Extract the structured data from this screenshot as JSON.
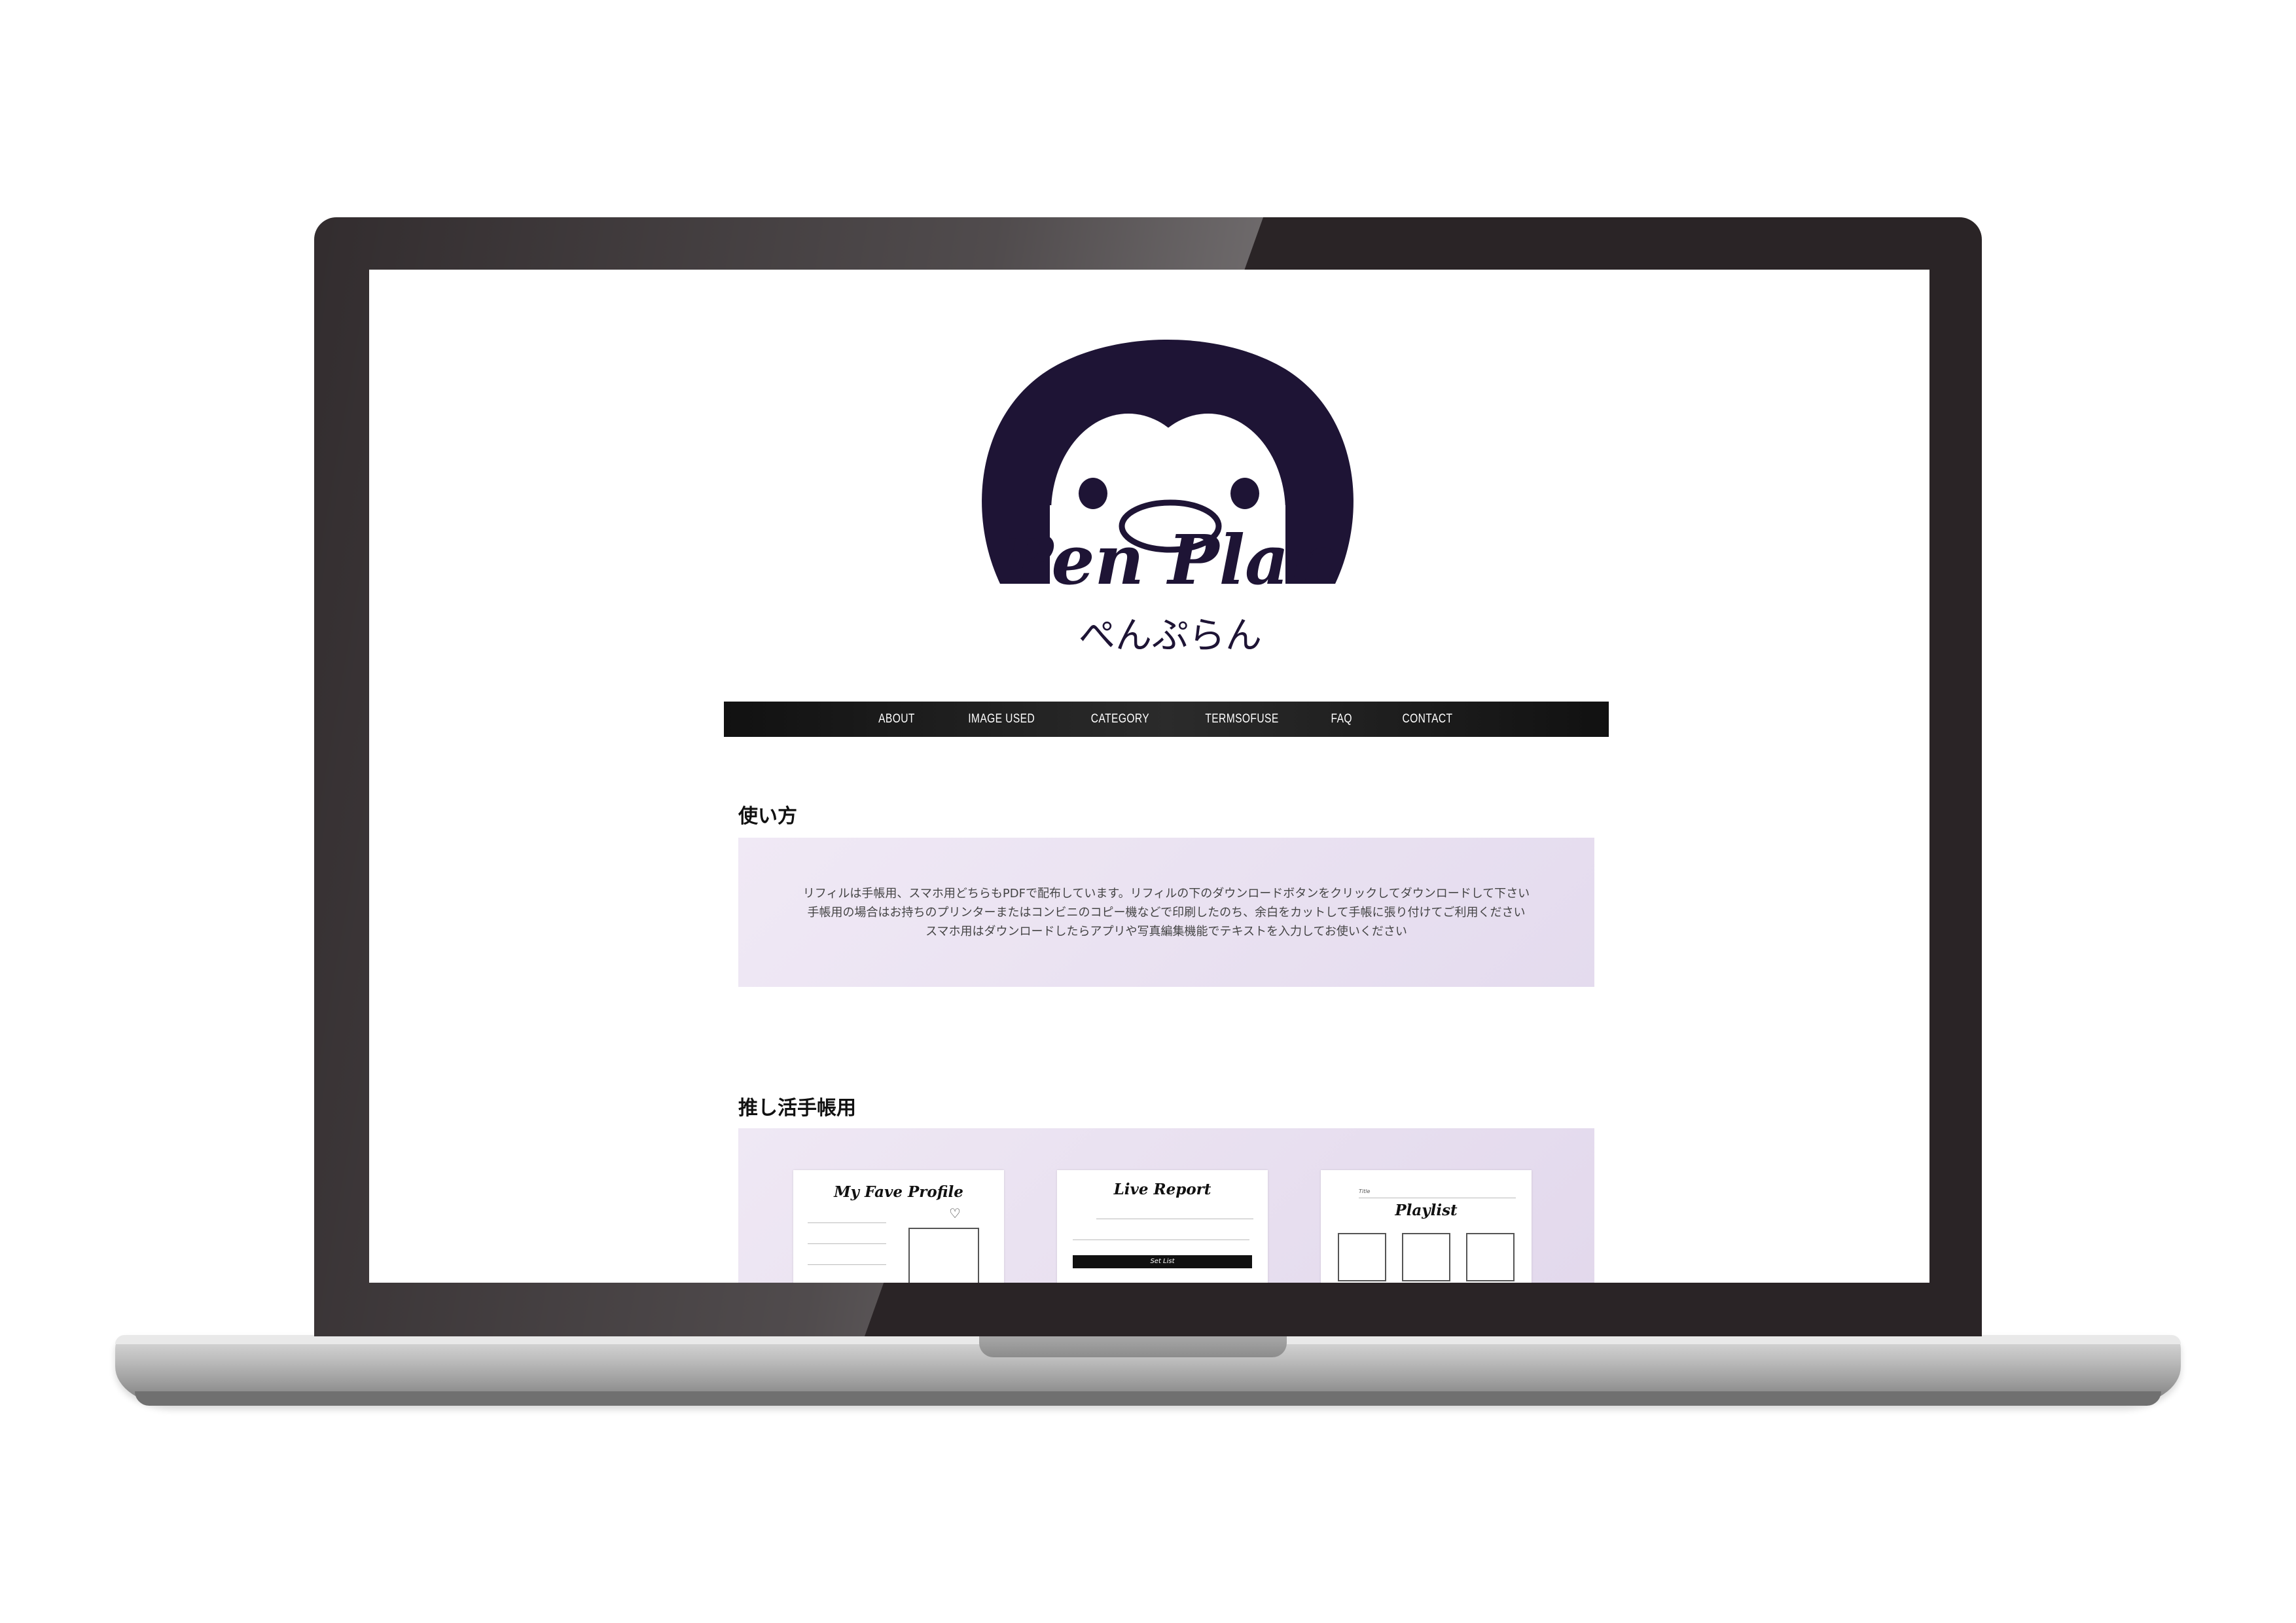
{
  "brand": {
    "logo_text": "Pen Plan",
    "logo_subtext": "ぺんぷらん"
  },
  "nav": {
    "items": [
      {
        "label": "ABOUT"
      },
      {
        "label": "IMAGE USED"
      },
      {
        "label": "CATEGORY"
      },
      {
        "label": "TERMSOFUSE"
      },
      {
        "label": "FAQ"
      },
      {
        "label": "CONTACT"
      }
    ]
  },
  "usage": {
    "title": "使い方",
    "lines": [
      "リフィルは手帳用、スマホ用どちらもPDFで配布しています。リフィルの下のダウンロードボタンをクリックしてダウンロードして下さい",
      "手帳用の場合はお持ちのプリンターまたはコンビニのコピー機などで印刷したのち、余白をカットして手帳に張り付けてご利用ください",
      "スマホ用はダウンロードしたらアプリや写真編集機能でテキストを入力してお使いください"
    ]
  },
  "oshi": {
    "title": "推し活手帳用",
    "cards": [
      {
        "title": "My Fave Profile"
      },
      {
        "title": "Live Report",
        "bar": "Set List"
      },
      {
        "title": "Playlist",
        "label": "Title"
      }
    ]
  },
  "colors": {
    "logo": "#1e1435",
    "nav_bg": "#1a1a1a",
    "box_bg": "#e9e1f1"
  }
}
